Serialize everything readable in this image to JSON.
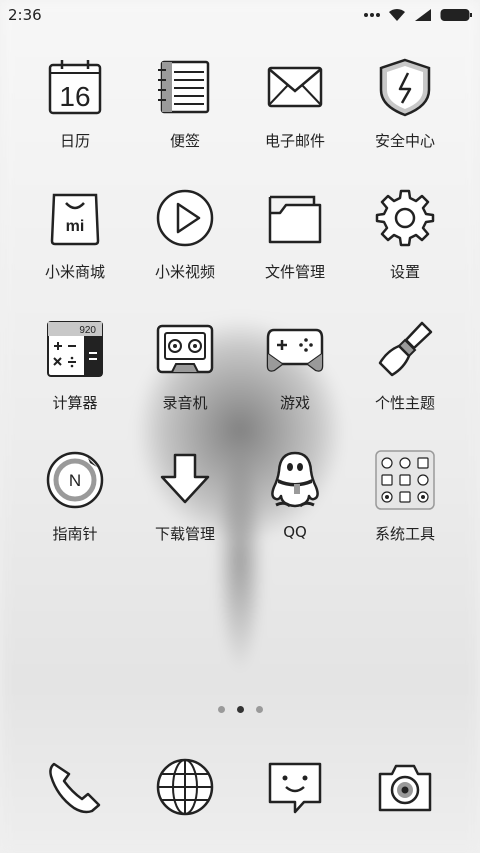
{
  "status": {
    "time": "2:36",
    "icons": [
      "more-dots-icon",
      "wifi-icon",
      "signal-icon",
      "battery-icon"
    ]
  },
  "apps": [
    {
      "label": "日历",
      "icon": "calendar-icon",
      "calendar_day": "16"
    },
    {
      "label": "便签",
      "icon": "notes-icon"
    },
    {
      "label": "电子邮件",
      "icon": "mail-icon"
    },
    {
      "label": "安全中心",
      "icon": "security-shield-icon"
    },
    {
      "label": "小米商城",
      "icon": "mi-store-bag-icon",
      "store_mark": "mi"
    },
    {
      "label": "小米视频",
      "icon": "video-play-icon"
    },
    {
      "label": "文件管理",
      "icon": "folder-icon"
    },
    {
      "label": "设置",
      "icon": "gear-icon"
    },
    {
      "label": "计算器",
      "icon": "calculator-icon",
      "display_value": "920"
    },
    {
      "label": "录音机",
      "icon": "tape-recorder-icon"
    },
    {
      "label": "游戏",
      "icon": "gamepad-icon"
    },
    {
      "label": "个性主题",
      "icon": "theme-brush-icon"
    },
    {
      "label": "指南针",
      "icon": "compass-icon",
      "compass_letter": "N"
    },
    {
      "label": "下载管理",
      "icon": "download-arrow-icon"
    },
    {
      "label": "QQ",
      "icon": "qq-penguin-icon"
    },
    {
      "label": "系统工具",
      "icon": "system-tools-folder-icon"
    }
  ],
  "page_indicator": {
    "count": 3,
    "active_index": 1
  },
  "dock": [
    {
      "icon": "phone-icon"
    },
    {
      "icon": "browser-globe-icon"
    },
    {
      "icon": "messaging-icon"
    },
    {
      "icon": "camera-icon"
    }
  ]
}
